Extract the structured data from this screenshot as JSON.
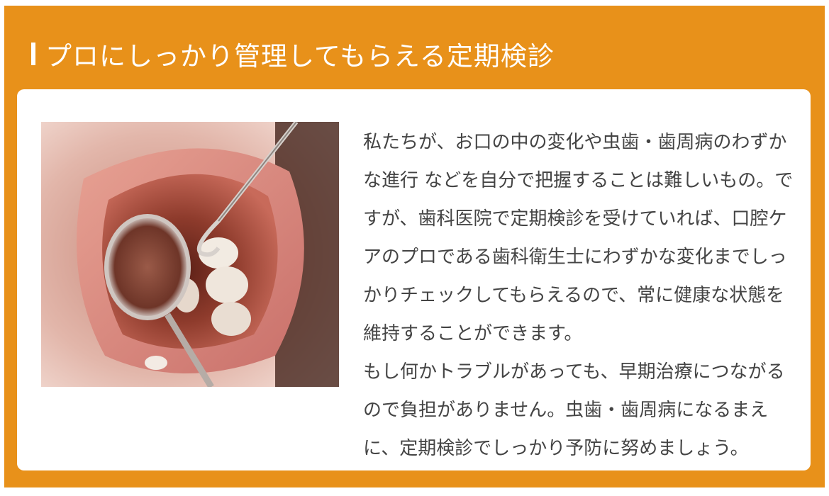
{
  "section": {
    "title": "プロにしっかり管理してもらえる定期検診",
    "paragraph_1": "私たちが、お口の中の変化や虫歯・歯周病のわずかな進行 などを自分で把握することは難しいもの。ですが、歯科医院で定期検診を受けていれば、口腔ケアのプロである歯科衛生士にわずかな変化までしっかりチェックしてもらえるので、常に健康な状態を維持することができます。",
    "paragraph_2": "もし何かトラブルがあっても、早期治療につながるので負担がありません。虫歯・歯周病になるまえに、定期検診でしっかり予防に努めましょう。"
  },
  "colors": {
    "accent": "#e8911a",
    "text": "#444444"
  }
}
